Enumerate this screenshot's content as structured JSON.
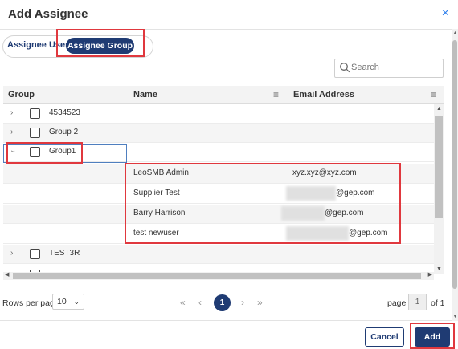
{
  "dialog": {
    "title": "Add Assignee",
    "close_glyph": "×"
  },
  "toggle": {
    "user_label": "Assignee User",
    "group_label": "Assignee Group",
    "selected": "Assignee Group"
  },
  "search": {
    "placeholder": "Search"
  },
  "grid": {
    "columns": {
      "group": "Group",
      "name": "Name",
      "email": "Email Address"
    },
    "groups": [
      {
        "label": "4534523",
        "expanded": false
      },
      {
        "label": "Group 2",
        "expanded": false
      },
      {
        "label": "Group1",
        "expanded": true
      },
      {
        "label": "TEST3R",
        "expanded": false
      }
    ],
    "members": [
      {
        "name": "LeoSMB Admin",
        "email": "xyz.xyz@xyz.com"
      },
      {
        "name": "Supplier Test",
        "email": "@gep.com"
      },
      {
        "name": "Barry Harrison",
        "email": "@gep.com"
      },
      {
        "name": "test newuser",
        "email": "@gep.com"
      }
    ]
  },
  "pagination": {
    "rows_per_page_label": "Rows per page",
    "rows_per_page_value": "10",
    "current_page": "1",
    "page_label": "page",
    "page_input": "1",
    "of_label": "of 1"
  },
  "footer": {
    "cancel_label": "Cancel",
    "add_label": "Add"
  },
  "colors": {
    "primary": "#1f3b73",
    "highlight": "#e0383e",
    "link": "#2f80ed"
  },
  "icons": [
    "close-icon",
    "search-icon",
    "menu-icon",
    "chevron-right-icon",
    "chevron-down-icon",
    "checkbox-icon",
    "first-page-icon",
    "prev-page-icon",
    "next-page-icon",
    "last-page-icon"
  ]
}
